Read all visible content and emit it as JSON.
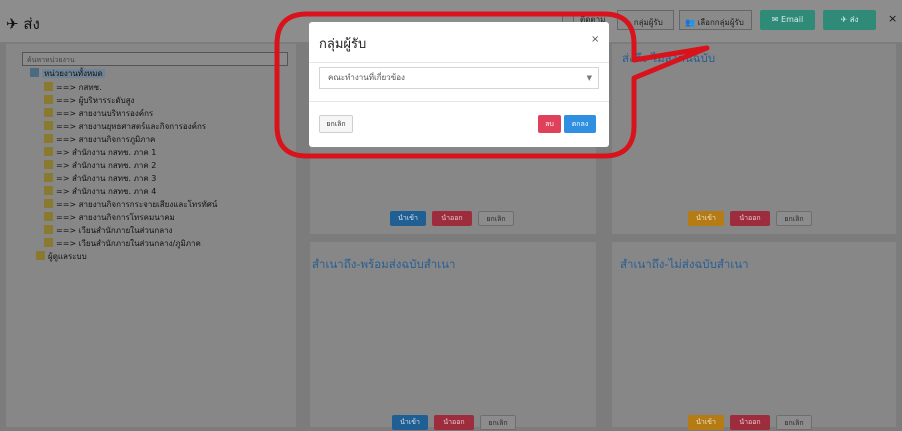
{
  "header": {
    "title": "ส่ง",
    "checkbox_label": "ติดตาม",
    "group_recipients_label": "กลุ่มผู้รับ",
    "select_group_label": "เลือกกลุ่มผู้รับ",
    "email_label": "Email",
    "send_label": "ส่ง",
    "close_label": "×"
  },
  "tree": {
    "search_placeholder": "ค้นหาหน่วยงาน",
    "root_label": "หน่วยงานทั้งหมด",
    "items": [
      "==> กสทช.",
      "==> ผู้บริหารระดับสูง",
      "==> สายงานบริหารองค์กร",
      "==> สายงานยุทธศาสตร์และกิจการองค์กร",
      "==> สายงานกิจการภูมิภาค",
      "=> สำนักงาน กสทช. ภาค 1",
      "=> สำนักงาน กสทช. ภาค 2",
      "=> สำนักงาน กสทช. ภาค 3",
      "=> สำนักงาน กสทช. ภาค 4",
      "==> สายงานกิจการกระจายเสียงและโทรทัศน์",
      "==> สายงานกิจการโทรคมนาคม",
      "==> เวียนสำนักภายในส่วนกลาง",
      "==> เวียนสำนักภายในส่วนกลาง/ภูมิภาค",
      "ผู้ดูแลระบบ"
    ]
  },
  "cards": {
    "top_right_title": "ส่งถึง-ไม่ส่งต้นฉบับ",
    "bottom_left_title": "สำเนาถึง-พร้อมส่งฉบับสำเนา",
    "bottom_right_title": "สำเนาถึง-ไม่ส่งฉบับสำเนา",
    "add_label": "นำเข้า",
    "remove_label": "นำออก",
    "cancel_label": "ยกเลิก"
  },
  "modal": {
    "title": "กลุ่มผู้รับ",
    "close": "×",
    "select_value": "คณะทำงานที่เกี่ยวข้อง",
    "cancel_label": "ยกเลิก",
    "delete_label": "ลบ",
    "ok_label": "ตกลง"
  },
  "colors": {
    "highlight": "#d8131b",
    "email_button": "#2f8a77",
    "delete_button": "#e0415a",
    "ok_button": "#2f8fe0"
  },
  "icons": {
    "send": "paper-plane-icon",
    "star": "star-icon",
    "users": "users-icon",
    "mail": "mail-icon",
    "folder": "folder-icon",
    "caret": "caret-down-icon"
  }
}
